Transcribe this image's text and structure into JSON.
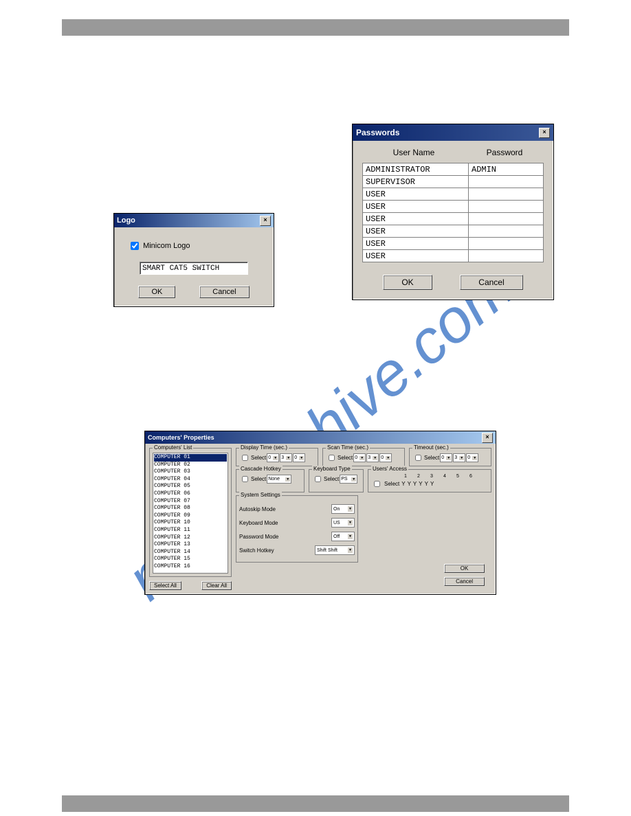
{
  "logo_dialog": {
    "title": "Logo",
    "checkbox_label": "Minicom Logo",
    "text_value": "SMART CAT5 SWITCH",
    "ok": "OK",
    "cancel": "Cancel"
  },
  "passwords_dialog": {
    "title": "Passwords",
    "col_user": "User Name",
    "col_pw": "Password",
    "rows": [
      {
        "user": "ADMINISTRATOR",
        "pw": "ADMIN"
      },
      {
        "user": "SUPERVISOR",
        "pw": ""
      },
      {
        "user": "USER",
        "pw": ""
      },
      {
        "user": "USER",
        "pw": ""
      },
      {
        "user": "USER",
        "pw": ""
      },
      {
        "user": "USER",
        "pw": ""
      },
      {
        "user": "USER",
        "pw": ""
      },
      {
        "user": "USER",
        "pw": ""
      }
    ],
    "ok": "OK",
    "cancel": "Cancel"
  },
  "computers_dialog": {
    "title": "Computers' Properties",
    "list_title": "Computers' List",
    "computers": [
      "COMPUTER 01",
      "COMPUTER 02",
      "COMPUTER 03",
      "COMPUTER 04",
      "COMPUTER 05",
      "COMPUTER 06",
      "COMPUTER 07",
      "COMPUTER 08",
      "COMPUTER 09",
      "COMPUTER 10",
      "COMPUTER 11",
      "COMPUTER 12",
      "COMPUTER 13",
      "COMPUTER 14",
      "COMPUTER 15",
      "COMPUTER 16"
    ],
    "select_all": "Select All",
    "clear_all": "Clear All",
    "display_time": {
      "title": "Display Time (sec.)",
      "select": "Select",
      "v": [
        "0",
        "3",
        "0"
      ]
    },
    "scan_time": {
      "title": "Scan Time (sec.)",
      "select": "Select",
      "v": [
        "0",
        "3",
        "0"
      ]
    },
    "timeout": {
      "title": "Timeout (sec.)",
      "select": "Select",
      "v": [
        "0",
        "3",
        "0"
      ]
    },
    "cascade": {
      "title": "Cascade Hotkey",
      "select": "Select",
      "value": "None"
    },
    "keyboard_type": {
      "title": "Keyboard Type",
      "select": "Select",
      "value": "PS"
    },
    "users_access": {
      "title": "Users' Access",
      "select": "Select",
      "cols": [
        "1",
        "2",
        "3",
        "4",
        "5",
        "6"
      ],
      "val": "Y"
    },
    "system_settings": {
      "title": "System Settings",
      "autoskip": {
        "label": "Autoskip Mode",
        "value": "On"
      },
      "keyboard_mode": {
        "label": "Keyboard Mode",
        "value": "US"
      },
      "password_mode": {
        "label": "Password Mode",
        "value": "Off"
      },
      "switch_hotkey": {
        "label": "Switch Hotkey",
        "value": "Shift Shift"
      }
    },
    "ok": "OK",
    "cancel": "Cancel"
  }
}
